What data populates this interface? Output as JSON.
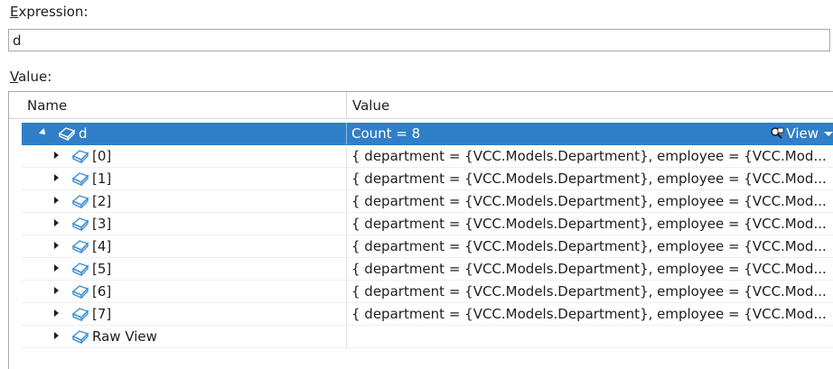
{
  "expression": {
    "label_accel": "E",
    "label_rest": "xpression:",
    "value": "d"
  },
  "value_section": {
    "label_accel": "V",
    "label_rest": "alue:"
  },
  "grid": {
    "columns": {
      "name": "Name",
      "value": "Value"
    },
    "root": {
      "name": "d",
      "value": "Count = 8",
      "view_label": "View",
      "expanded": true,
      "selected": true
    },
    "children": [
      {
        "name": "[0]",
        "value": "{ department = {VCC.Models.Department}, employee = {VCC.Mod..."
      },
      {
        "name": "[1]",
        "value": "{ department = {VCC.Models.Department}, employee = {VCC.Mod..."
      },
      {
        "name": "[2]",
        "value": "{ department = {VCC.Models.Department}, employee = {VCC.Mod..."
      },
      {
        "name": "[3]",
        "value": "{ department = {VCC.Models.Department}, employee = {VCC.Mod..."
      },
      {
        "name": "[4]",
        "value": "{ department = {VCC.Models.Department}, employee = {VCC.Mod..."
      },
      {
        "name": "[5]",
        "value": "{ department = {VCC.Models.Department}, employee = {VCC.Mod..."
      },
      {
        "name": "[6]",
        "value": "{ department = {VCC.Models.Department}, employee = {VCC.Mod..."
      },
      {
        "name": "[7]",
        "value": "{ department = {VCC.Models.Department}, employee = {VCC.Mod..."
      }
    ],
    "raw_view": {
      "name": "Raw View",
      "value": ""
    }
  },
  "icons": {
    "object": "object-cube-icon",
    "visualizer": "magnifier-visualizer-icon"
  },
  "colors": {
    "selection": "#2f7fc9",
    "icon_blue": "#3a8fd8"
  }
}
